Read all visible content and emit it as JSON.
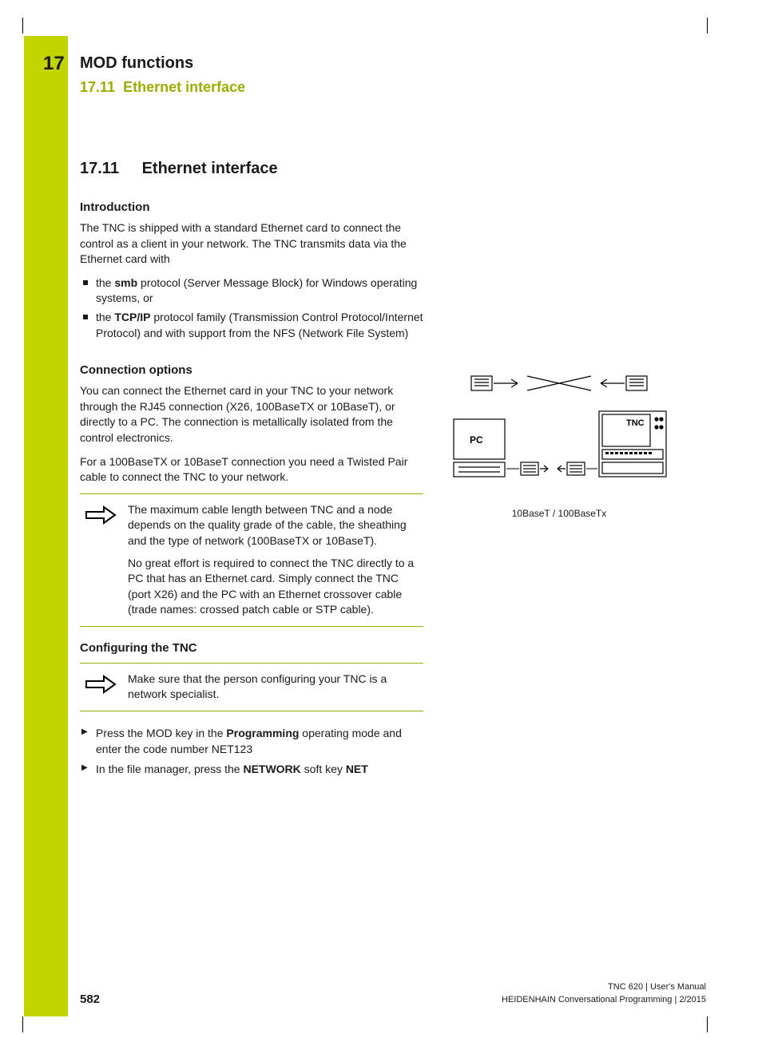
{
  "chapter": {
    "num": "17",
    "title": "MOD functions",
    "subnum": "17.11",
    "subtitle": "Ethernet interface"
  },
  "section": {
    "num": "17.11",
    "title": "Ethernet interface"
  },
  "intro": {
    "heading": "Introduction",
    "p1": "The TNC is shipped with a standard Ethernet card to connect the control as a client in your network. The TNC transmits data via the Ethernet card with",
    "b1a": "the ",
    "b1b": "smb",
    "b1c": " protocol (Server Message Block) for Windows operating systems, or",
    "b2a": "the ",
    "b2b": "TCP/IP",
    "b2c": " protocol family (Transmission Control Protocol/Internet Protocol) and with support from the NFS (Network File System)"
  },
  "conn": {
    "heading": "Connection options",
    "p1": "You can connect the Ethernet card in your TNC to your network through the RJ45 connection (X26, 100BaseTX or 10BaseT), or directly to a PC. The connection is metallically isolated from the control electronics.",
    "p2": "For a 100BaseTX or 10BaseT connection you need a Twisted Pair cable to connect the TNC to your network.",
    "note1": "The maximum cable length between TNC and a node depends on the quality grade of the cable, the sheathing and the type of network (100BaseTX or 10BaseT).",
    "note2": "No great effort is required to connect the TNC directly to a PC that has an Ethernet card. Simply connect the TNC (port X26) and the PC with an Ethernet crossover cable (trade names: crossed patch cable or STP cable)."
  },
  "config": {
    "heading": "Configuring the TNC",
    "note": "Make sure that the person configuring your TNC is a network specialist.",
    "s1a": "Press the MOD key in the ",
    "s1b": "Programming",
    "s1c": " operating mode and enter the code number NET123",
    "s2a": "In the file manager, press the ",
    "s2b": "NETWORK",
    "s2c": " soft key ",
    "s2d": "NET"
  },
  "diagram": {
    "pc": "PC",
    "tnc": "TNC",
    "caption": "10BaseT / 100BaseTx"
  },
  "footer": {
    "page": "582",
    "line1": "TNC 620 | User's Manual",
    "line2": "HEIDENHAIN Conversational Programming | 2/2015"
  }
}
